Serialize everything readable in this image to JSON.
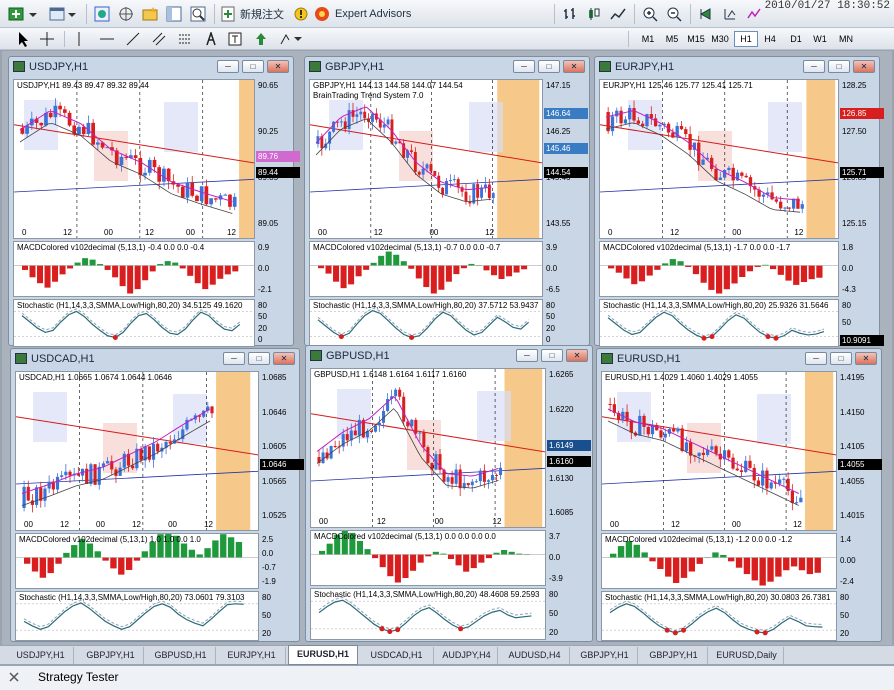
{
  "toolbar": {
    "new_order_label": "新規注文",
    "expert_advisors_label": "Expert Advisors",
    "timeframes": [
      "M1",
      "M5",
      "M15",
      "M30",
      "H1",
      "H4",
      "D1",
      "W1",
      "MN"
    ],
    "selected_timeframe": "H1",
    "clock": "2010/01/27 18:30:52"
  },
  "windows": [
    {
      "title": "USDJPY,H1",
      "header": "USDJPY,H1  89.43 89.47 89.32 89.44",
      "price_ticks": [
        "90.65",
        "90.25",
        "89.85",
        "89.05"
      ],
      "current_price": "89.44",
      "alt_price": "89.76",
      "x_labels": [
        "0",
        "12",
        "00",
        "12",
        "00",
        "12"
      ],
      "macd_label": "MACDColored v102decimal (5,13,1) -0.4 0.0 0.0 -0.4",
      "macd_ticks": [
        "0.9",
        "0.0",
        "-2.1"
      ],
      "stoch_label": "Stochastic (H1,14,3,3,SMMA,Low/High,80,20) 34.5125 49.1620",
      "stoch_ticks": [
        "80",
        "50",
        "20",
        "0"
      ],
      "macd_values": [
        -0.3,
        -0.8,
        -1.2,
        -1.5,
        -1.1,
        -0.6,
        -0.2,
        0.2,
        0.5,
        0.4,
        0.1,
        -0.3,
        -0.8,
        -1.4,
        -1.9,
        -1.6,
        -1.0,
        -0.4,
        0.1,
        0.3,
        0.2,
        -0.2,
        -0.7,
        -1.2,
        -1.6,
        -1.3,
        -0.9,
        -0.6,
        -0.4
      ],
      "stoch_values": [
        70,
        55,
        40,
        30,
        35,
        55,
        72,
        80,
        68,
        50,
        35,
        22,
        18,
        30,
        52,
        70,
        75,
        60,
        42,
        28,
        25,
        38,
        60,
        78,
        70,
        52,
        38,
        34,
        49
      ]
    },
    {
      "title": "GBPJPY,H1",
      "header": "GBPJPY,H1  144.13 144.58 144.07 144.54",
      "subheader": "BrainTrading Trend System 7.0",
      "price_ticks": [
        "147.15",
        "146.25",
        "145.46",
        "143.55"
      ],
      "current_price": "144.54",
      "level_a": "146.64",
      "level_b": "145.46",
      "x_labels": [
        "00",
        "12",
        "00",
        "12"
      ],
      "macd_label": "MACDColored v102decimal (5,13,1) -0.7 0.0 0.0 -0.7",
      "macd_ticks": [
        "3.9",
        "0.0",
        "-6.5"
      ],
      "stoch_label": "Stochastic (H1,14,3,3,SMMA,Low/High,80,20) 37.5712 53.9437",
      "stoch_ticks": [
        "80",
        "50",
        "20",
        "0"
      ],
      "macd_values": [
        -0.5,
        -1.5,
        -3.0,
        -4.2,
        -3.5,
        -2.0,
        -0.8,
        0.5,
        1.8,
        2.6,
        2.0,
        0.8,
        -0.6,
        -2.4,
        -4.0,
        -5.2,
        -4.5,
        -3.0,
        -1.6,
        -0.5,
        0.3,
        0.0,
        -0.9,
        -1.8,
        -2.5,
        -2.0,
        -1.3,
        -0.7
      ],
      "stoch_values": [
        60,
        45,
        30,
        20,
        28,
        50,
        70,
        82,
        75,
        58,
        40,
        25,
        18,
        22,
        40,
        62,
        78,
        70,
        52,
        35,
        24,
        30,
        48,
        66,
        55,
        42,
        38,
        54
      ]
    },
    {
      "title": "EURJPY,H1",
      "header": "EURJPY,H1  125.46 125.77 125.41 125.71",
      "price_ticks": [
        "128.25",
        "127.50",
        "126.85",
        "125.15"
      ],
      "current_price": "125.71",
      "level_a": "126.85",
      "x_labels": [
        "0",
        "12",
        "00",
        "12"
      ],
      "macd_label": "MACDColored v102decimal (5,13,1) -1.7 0.0 0.0 -1.7",
      "macd_ticks": [
        "1.8",
        "0.0",
        "-4.3"
      ],
      "stoch_label": "Stochastic (H1,14,3,3,SMMA,Low/High,80,20) 25.9326 31.5646",
      "stoch_ticks": [
        "80",
        "50",
        "20"
      ],
      "stoch_badge": "10.9091",
      "macd_values": [
        -0.4,
        -1.0,
        -1.8,
        -2.6,
        -2.2,
        -1.4,
        -0.6,
        0.3,
        0.9,
        0.6,
        -0.2,
        -1.2,
        -2.4,
        -3.4,
        -3.9,
        -3.3,
        -2.5,
        -1.6,
        -0.8,
        -0.2,
        0.1,
        -0.5,
        -1.3,
        -2.1,
        -2.7,
        -2.3,
        -1.9,
        -1.7
      ],
      "stoch_values": [
        65,
        50,
        35,
        25,
        30,
        48,
        66,
        78,
        70,
        52,
        36,
        24,
        16,
        20,
        38,
        58,
        72,
        64,
        46,
        30,
        20,
        16,
        22,
        35,
        28,
        24,
        26,
        32
      ]
    },
    {
      "title": "USDCAD,H1",
      "header": "USDCAD,H1  1.0665 1.0674 1.0644 1.0646",
      "price_ticks": [
        "1.0685",
        "1.0646",
        "1.0605",
        "1.0565",
        "1.0525"
      ],
      "current_price": "1.0646",
      "x_labels": [
        "00",
        "12",
        "00",
        "12",
        "00",
        "12"
      ],
      "macd_label": "MACDColored v102decimal (5,13,1) 1.0 1.0 0.0 1.0",
      "macd_ticks": [
        "2.5",
        "0.0",
        "-0.7",
        "-1.9"
      ],
      "stoch_label": "Stochastic (H1,14,3,3,SMMA,Low/High,80,20) 73.0601 79.3103",
      "stoch_ticks": [
        "80",
        "50",
        "20"
      ],
      "macd_values": [
        -0.4,
        -0.9,
        -1.3,
        -1.0,
        -0.4,
        0.3,
        0.8,
        1.2,
        0.9,
        0.4,
        -0.2,
        -0.7,
        -1.1,
        -0.8,
        -0.2,
        0.4,
        1.0,
        1.5,
        1.8,
        1.4,
        0.9,
        0.5,
        0.2,
        0.6,
        1.1,
        1.5,
        1.3,
        1.0
      ],
      "stoch_values": [
        40,
        30,
        22,
        28,
        45,
        62,
        75,
        82,
        70,
        55,
        40,
        30,
        22,
        28,
        44,
        60,
        74,
        80,
        72,
        56,
        44,
        36,
        30,
        45,
        62,
        78,
        80,
        79
      ]
    },
    {
      "title": "GBPUSD,H1",
      "header": "GBPUSD,H1  1.6148 1.6164 1.6117 1.6160",
      "price_ticks": [
        "1.6265",
        "1.6220",
        "1.6175",
        "1.6130",
        "1.6085"
      ],
      "current_price": "1.6160",
      "alt_price": "1.6149",
      "x_labels": [
        "00",
        "12",
        "00",
        "12"
      ],
      "macd_label": "MACDColored v102decimal (5,13,1) 0.0 0.0 0.0 0.0",
      "macd_ticks": [
        "3.7",
        "0.0",
        "-3.9"
      ],
      "stoch_label": "Stochastic (H1,14,3,3,SMMA,Low/High,80,20) 48.4608 59.2593",
      "stoch_ticks": [
        "80",
        "50",
        "20"
      ],
      "macd_values": [
        0.4,
        1.2,
        2.2,
        2.9,
        2.4,
        1.5,
        0.6,
        -0.4,
        -1.4,
        -2.4,
        -3.1,
        -2.6,
        -1.8,
        -0.9,
        -0.2,
        0.3,
        0.1,
        -0.5,
        -1.2,
        -1.9,
        -1.5,
        -0.9,
        -0.4,
        0.2,
        0.5,
        0.3,
        0.1,
        0.0
      ],
      "stoch_values": [
        55,
        68,
        78,
        82,
        72,
        58,
        44,
        30,
        20,
        14,
        18,
        32,
        48,
        60,
        66,
        54,
        40,
        28,
        20,
        24,
        36,
        48,
        56,
        60,
        50,
        44,
        46,
        48
      ]
    },
    {
      "title": "EURUSD,H1",
      "header": "EURUSD,H1  1.4029 1.4060 1.4029 1.4055",
      "price_ticks": [
        "1.4195",
        "1.4150",
        "1.4105",
        "1.4055",
        "1.4015"
      ],
      "current_price": "1.4055",
      "x_labels": [
        "00",
        "12",
        "00",
        "12"
      ],
      "macd_label": "MACDColored v102decimal (5,13,1) -1.2 0.0 0.0 -1.2",
      "macd_ticks": [
        "1.4",
        "0.00",
        "-2.4"
      ],
      "stoch_label": "Stochastic (H1,14,3,3,SMMA,Low/High,80,20) 30.0803 26.7381",
      "stoch_ticks": [
        "80",
        "50",
        "20"
      ],
      "macd_values": [
        0.3,
        0.9,
        1.3,
        1.0,
        0.4,
        -0.3,
        -0.9,
        -1.5,
        -2.0,
        -1.6,
        -1.1,
        -0.5,
        0.0,
        0.4,
        0.2,
        -0.3,
        -0.8,
        -1.3,
        -1.8,
        -2.2,
        -1.9,
        -1.5,
        -1.0,
        -0.7,
        -1.0,
        -1.3,
        -1.2
      ],
      "stoch_values": [
        60,
        72,
        80,
        74,
        60,
        44,
        30,
        20,
        14,
        20,
        34,
        50,
        62,
        70,
        60,
        44,
        30,
        22,
        16,
        14,
        22,
        36,
        48,
        40,
        30,
        28,
        27
      ]
    }
  ],
  "tabs": [
    "USDJPY,H1",
    "GBPJPY,H1",
    "GBPUSD,H1",
    "EURJPY,H1",
    "EURUSD,H1",
    "USDCAD,H1",
    "AUDJPY,H4",
    "AUDUSD,H4",
    "GBPJPY,H1",
    "GBPJPY,H1",
    "EURUSD,Daily"
  ],
  "active_tab": "EURUSD,H1",
  "status": {
    "strategy_tester_label": "Strategy Tester"
  },
  "colors": {
    "bull": "#3b73d8",
    "bear": "#d81e1e",
    "macd_pos": "#1e9a3c",
    "macd_neg": "#d81e1e",
    "session": "#f6c98a",
    "ma_red": "#d41a1a",
    "ma_magenta": "#c21fc2"
  }
}
